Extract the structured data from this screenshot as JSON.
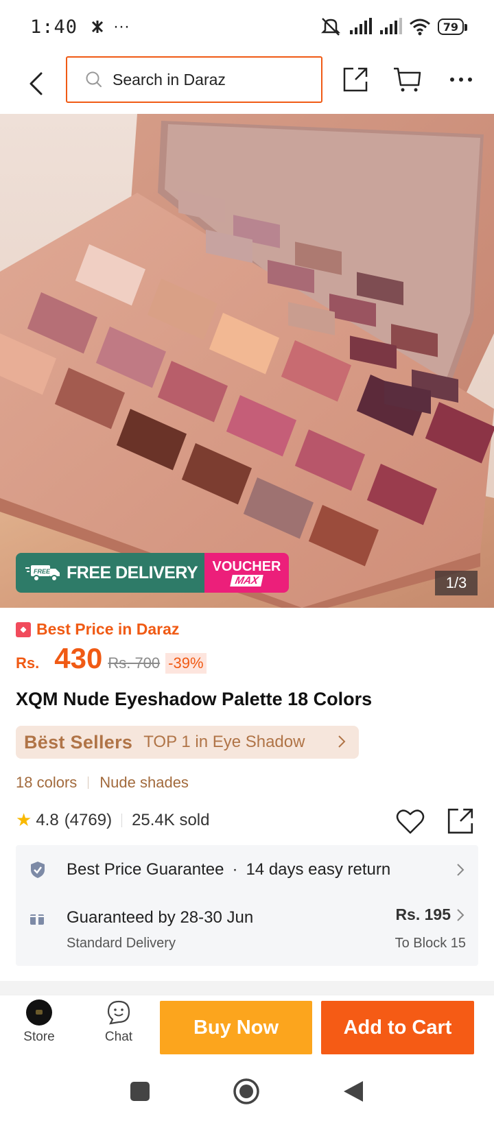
{
  "status_bar": {
    "time": "1:40",
    "more_indicator": "···",
    "battery": "79",
    "icons": [
      "bluetooth-icon",
      "mute-icon",
      "signal-icon",
      "signal-icon",
      "wifi-icon",
      "battery-icon"
    ]
  },
  "header": {
    "search_placeholder": "Search in Daraz",
    "icons": [
      "back-arrow-icon",
      "search-icon",
      "share-icon",
      "cart-icon",
      "more-icon"
    ]
  },
  "gallery": {
    "counter": "1/3",
    "promo": {
      "free_badge": "FREE",
      "free_delivery": "FREE DELIVERY",
      "voucher_line1": "VOUCHER",
      "voucher_line2": "MAX"
    }
  },
  "product": {
    "best_price_label": "Best Price in Daraz",
    "currency": "Rs.",
    "price": "430",
    "original_price": "Rs. 700",
    "discount": "-39%",
    "title": "XQM Nude Eyeshadow Palette 18 Colors",
    "best_sellers": {
      "label": "Bëst Sellers",
      "rank": "TOP 1 in Eye Shadow"
    },
    "variants": [
      "18 colors",
      "Nude shades"
    ],
    "rating": "4.8",
    "reviews": "(4769)",
    "sold": "25.4K sold"
  },
  "services": {
    "guarantee": "Best Price Guarantee",
    "dot": "·",
    "returns": "14 days easy return",
    "delivery_date": "Guaranteed by 28-30 Jun",
    "delivery_type": "Standard Delivery",
    "delivery_fee": "Rs. 195",
    "delivery_location": "To Block 15"
  },
  "bottom_bar": {
    "store": "Store",
    "chat": "Chat",
    "buy_now": "Buy Now",
    "add_to_cart": "Add to Cart"
  },
  "colors": {
    "brand_orange": "#f55b15",
    "buy_now": "#fca51d",
    "free_delivery_green": "#2e7b68",
    "voucher_pink": "#ec1f7a",
    "best_sellers_bg": "#f6e6dc"
  }
}
